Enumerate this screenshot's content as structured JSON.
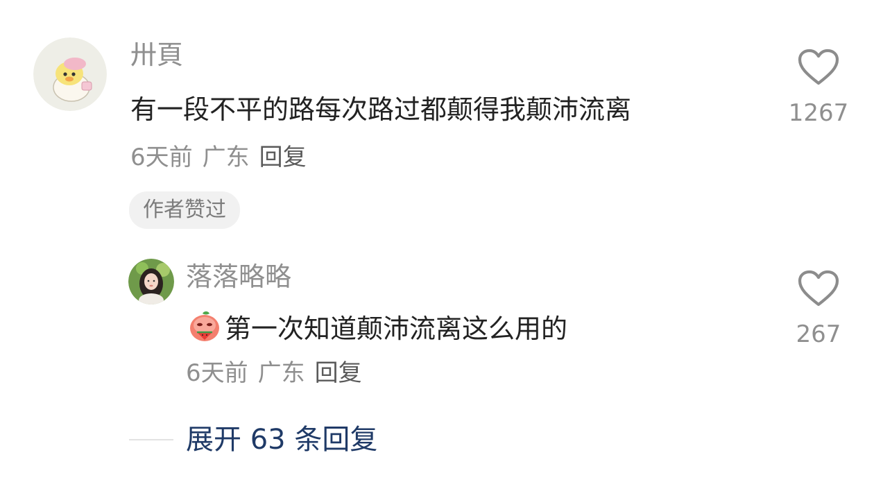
{
  "comments": [
    {
      "username": "卅頁",
      "text": "有一段不平的路每次路过都颠得我颠沛流离",
      "time": "6天前",
      "location": "广东",
      "reply_label": "回复",
      "badge": "作者赞过",
      "like_count": "1267",
      "avatar_icon": "duck-avatar-icon"
    },
    {
      "username": "落落略略",
      "text": "第一次知道颠沛流离这么用的",
      "emoji_icon": "watermelon-face-emoji-icon",
      "time": "6天前",
      "location": "广东",
      "reply_label": "回复",
      "like_count": "267",
      "avatar_icon": "girl-photo-avatar-icon"
    }
  ],
  "expand_replies": "展开 63 条回复",
  "colors": {
    "username": "#8f8f8f",
    "text": "#222222",
    "expand_link": "#1f3a67",
    "badge_bg": "#f1f1f1"
  }
}
